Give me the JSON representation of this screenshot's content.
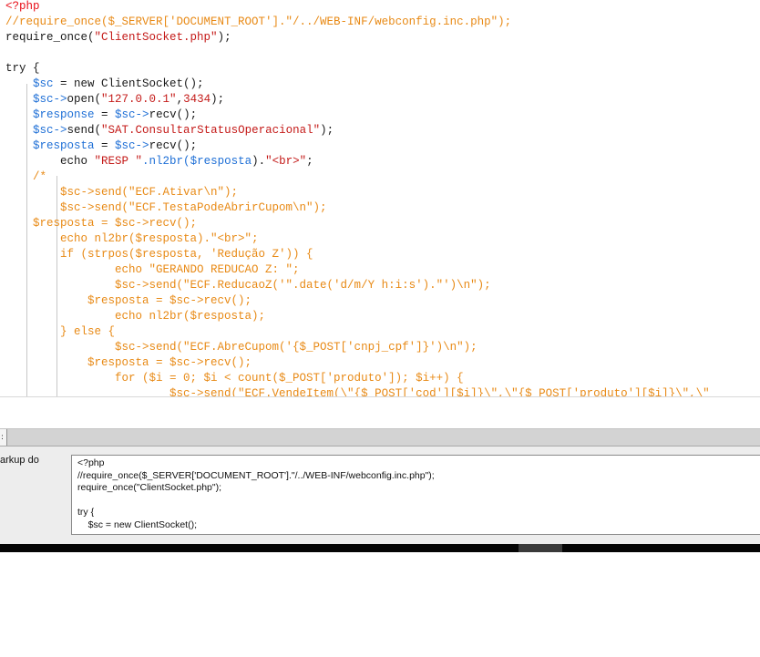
{
  "code_lines": [
    [
      {
        "t": "<?php",
        "c": "red"
      }
    ],
    [
      {
        "t": "//require_once($_SERVER['DOCUMENT_ROOT'].\"/../WEB-INF/webconfig.inc.php\");",
        "c": "org"
      }
    ],
    [
      {
        "t": "require_once(",
        "c": "blk"
      },
      {
        "t": "\"ClientSocket.php\"",
        "c": "str"
      },
      {
        "t": ");",
        "c": "blk"
      }
    ],
    [],
    [
      {
        "t": "try {",
        "c": "blk"
      }
    ],
    [
      {
        "t": "    ",
        "c": "blk"
      },
      {
        "t": "$sc",
        "c": "blu"
      },
      {
        "t": " = new ClientSocket();",
        "c": "blk"
      }
    ],
    [
      {
        "t": "    ",
        "c": "blk"
      },
      {
        "t": "$sc->",
        "c": "blu"
      },
      {
        "t": "open(",
        "c": "blk"
      },
      {
        "t": "\"127.0.0.1\"",
        "c": "str"
      },
      {
        "t": ",",
        "c": "blk"
      },
      {
        "t": "3434",
        "c": "str"
      },
      {
        "t": ");",
        "c": "blk"
      }
    ],
    [
      {
        "t": "    ",
        "c": "blk"
      },
      {
        "t": "$response",
        "c": "blu"
      },
      {
        "t": " = ",
        "c": "blk"
      },
      {
        "t": "$sc->",
        "c": "blu"
      },
      {
        "t": "recv();",
        "c": "blk"
      }
    ],
    [
      {
        "t": "    ",
        "c": "blk"
      },
      {
        "t": "$sc->",
        "c": "blu"
      },
      {
        "t": "send(",
        "c": "blk"
      },
      {
        "t": "\"SAT.ConsultarStatusOperacional\"",
        "c": "str"
      },
      {
        "t": ");",
        "c": "blk"
      }
    ],
    [
      {
        "t": "    ",
        "c": "blk"
      },
      {
        "t": "$resposta",
        "c": "blu"
      },
      {
        "t": " = ",
        "c": "blk"
      },
      {
        "t": "$sc->",
        "c": "blu"
      },
      {
        "t": "recv();",
        "c": "blk"
      }
    ],
    [
      {
        "t": "        echo ",
        "c": "blk"
      },
      {
        "t": "\"RESP \"",
        "c": "str"
      },
      {
        "t": ".nl2br(",
        "c": "blu"
      },
      {
        "t": "$resposta",
        "c": "blu"
      },
      {
        "t": ").",
        "c": "blk"
      },
      {
        "t": "\"<br>\"",
        "c": "str"
      },
      {
        "t": ";",
        "c": "blk"
      }
    ],
    [
      {
        "t": "    /*",
        "c": "org"
      }
    ],
    [
      {
        "t": "        $sc->send(\"ECF.Ativar\\n\");",
        "c": "org"
      }
    ],
    [
      {
        "t": "        $sc->send(\"ECF.TestaPodeAbrirCupom\\n\");",
        "c": "org"
      }
    ],
    [
      {
        "t": "    $resposta = $sc->recv();",
        "c": "org"
      }
    ],
    [
      {
        "t": "        echo nl2br($resposta).\"<br>\";",
        "c": "org"
      }
    ],
    [
      {
        "t": "        if (strpos($resposta, 'Redução Z')) {",
        "c": "org"
      }
    ],
    [
      {
        "t": "                echo \"GERANDO REDUCAO Z: \";",
        "c": "org"
      }
    ],
    [
      {
        "t": "                $sc->send(\"ECF.ReducaoZ('\".date('d/m/Y h:i:s').\"')\\n\");",
        "c": "org"
      }
    ],
    [
      {
        "t": "            $resposta = $sc->recv();",
        "c": "org"
      }
    ],
    [
      {
        "t": "                echo nl2br($resposta);",
        "c": "org"
      }
    ],
    [
      {
        "t": "        } else {",
        "c": "org"
      }
    ],
    [
      {
        "t": "                $sc->send(\"ECF.AbreCupom('{$_POST['cnpj_cpf']}')\\n\");",
        "c": "org"
      }
    ],
    [
      {
        "t": "            $resposta = $sc->recv();",
        "c": "org"
      }
    ],
    [
      {
        "t": "                for ($i = 0; $i < count($_POST['produto']); $i++) {",
        "c": "org"
      }
    ],
    [
      {
        "t": "                        $sc->send(\"ECF.VendeItem(\\\"{$_POST['cod'][$i]}\\\",\\\"{$_POST['produto'][$i]}\\\",\\\"",
        "c": "org"
      }
    ]
  ],
  "colors": {
    "red": "#e8101a",
    "org": "#e88a16",
    "blk": "#1a1a1a",
    "blu": "#1e6fd6",
    "str": "#c41a18"
  },
  "panel": {
    "label": "arkup do",
    "tab_mark": ":",
    "markup_lines": [
      "<?php",
      "//require_once($_SERVER['DOCUMENT_ROOT'].\"/../WEB-INF/webconfig.inc.php\");",
      "require_once(\"ClientSocket.php\");",
      "",
      "try {",
      "    $sc = new ClientSocket();"
    ]
  }
}
